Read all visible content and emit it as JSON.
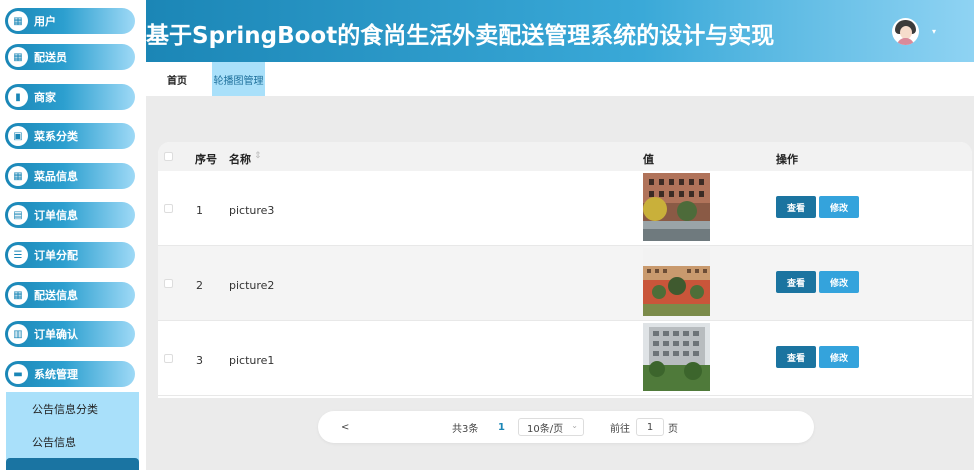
{
  "header": {
    "title": "基于SpringBoot的食尚生活外卖配送管理系统的设计与实现",
    "caret": "▾"
  },
  "sidebar": {
    "items": [
      {
        "label": "用户",
        "icon": "grid-icon"
      },
      {
        "label": "配送员",
        "icon": "grid-icon"
      },
      {
        "label": "商家",
        "icon": "bar-chart-icon"
      },
      {
        "label": "菜系分类",
        "icon": "clipboard-icon"
      },
      {
        "label": "菜品信息",
        "icon": "grid-icon"
      },
      {
        "label": "订单信息",
        "icon": "document-icon"
      },
      {
        "label": "订单分配",
        "icon": "list-icon"
      },
      {
        "label": "配送信息",
        "icon": "grid-icon"
      },
      {
        "label": "订单确认",
        "icon": "book-icon"
      },
      {
        "label": "系统管理",
        "icon": "message-icon"
      }
    ],
    "submenu": [
      {
        "label": "公告信息分类"
      },
      {
        "label": "公告信息"
      }
    ]
  },
  "tabs": {
    "home": "首页",
    "active": "轮播图管理"
  },
  "table": {
    "headers": {
      "index": "序号",
      "name": "名称",
      "sort": "⇕",
      "value": "值",
      "actions": "操作"
    },
    "rows": [
      {
        "index": "1",
        "name": "picture3",
        "view": "查看",
        "edit": "修改"
      },
      {
        "index": "2",
        "name": "picture2",
        "view": "查看",
        "edit": "修改"
      },
      {
        "index": "3",
        "name": "picture1",
        "view": "查看",
        "edit": "修改"
      }
    ]
  },
  "pagination": {
    "prev": "<",
    "total": "共3条",
    "current": "1",
    "page_size": "10条/页",
    "goto": "前往",
    "goto_value": "1",
    "page_suffix": "页"
  },
  "colors": {
    "primary": "#1b86b6",
    "view_button": "#1b74a0",
    "edit_button": "#34a3dc",
    "highlight": "#a9e0fa"
  }
}
